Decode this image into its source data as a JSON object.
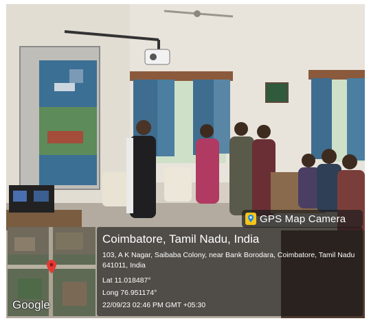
{
  "overlay": {
    "badge_label": "GPS Map Camera",
    "city": "Coimbatore, Tamil Nadu, India",
    "address": "103, A K Nagar, Saibaba Colony, near Bank Borodara, Coimbatore, Tamil Nadu 641011, India",
    "latitude": "Lat 11.018487°",
    "longitude": "Long 76.951174°",
    "datetime": "22/09/23 02:46 PM GMT +05:30"
  },
  "map": {
    "provider_label": "Google",
    "pin_color": "#e53935"
  },
  "scene": {
    "icons": [
      "projector-icon",
      "projection-screen",
      "window-curtains",
      "laptop-icon",
      "map-pin-icon",
      "camera-app-icon"
    ]
  }
}
